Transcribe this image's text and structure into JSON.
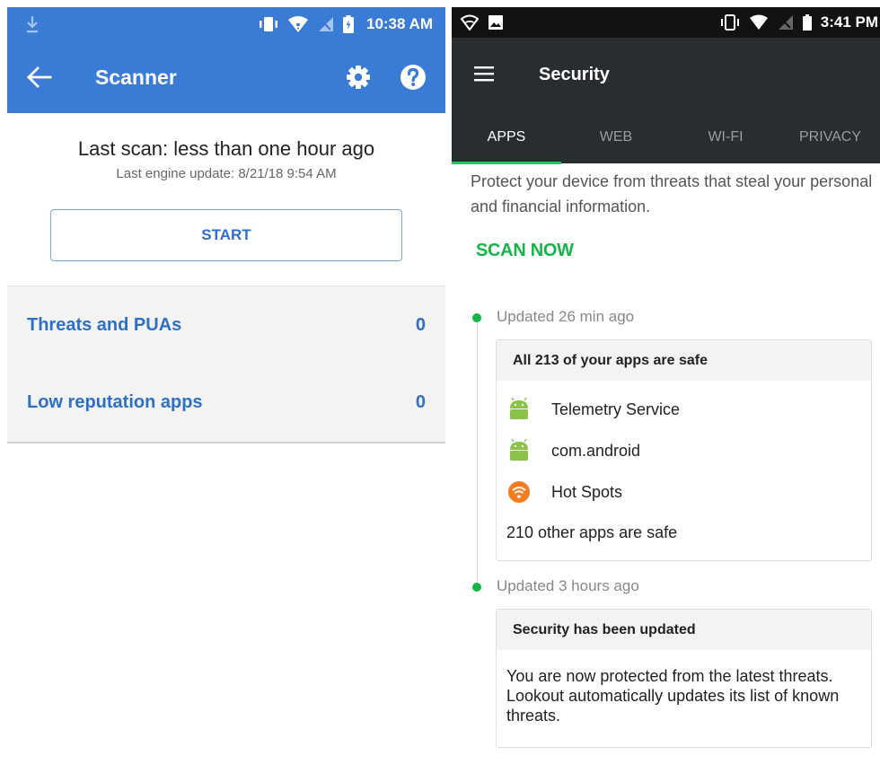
{
  "left": {
    "status": {
      "time": "10:38 AM"
    },
    "appbar": {
      "title": "Scanner"
    },
    "scan": {
      "last_scan": "Last scan: less than one hour ago",
      "engine_update": "Last engine update: 8/21/18 9:54 AM",
      "start_label": "START"
    },
    "results": [
      {
        "label": "Threats and PUAs",
        "count": "0"
      },
      {
        "label": "Low reputation apps",
        "count": "0"
      }
    ],
    "accent": "#3a7bd5"
  },
  "right": {
    "status": {
      "time": "3:41 PM"
    },
    "appbar": {
      "title": "Security"
    },
    "tabs": [
      {
        "label": "APPS",
        "active": true
      },
      {
        "label": "WEB",
        "active": false
      },
      {
        "label": "WI-FI",
        "active": false
      },
      {
        "label": "PRIVACY",
        "active": false
      }
    ],
    "intro": "Protect your device from threats that steal your personal and financial information.",
    "scan_now": "SCAN NOW",
    "timeline": [
      {
        "updated": "Updated 26 min ago",
        "card_title": "All 213 of your apps are safe",
        "apps": [
          {
            "name": "Telemetry Service",
            "icon": "android-icon"
          },
          {
            "name": "com.android",
            "icon": "android-icon"
          },
          {
            "name": "Hot Spots",
            "icon": "wifi-hotspot-icon"
          }
        ],
        "footer": "210 other apps are safe"
      },
      {
        "updated": "Updated 3 hours ago",
        "card_title": "Security has been updated",
        "body": "You are now protected from the latest threats. Lookout automatically updates its list of known threats."
      }
    ],
    "accent": "#16b548"
  }
}
